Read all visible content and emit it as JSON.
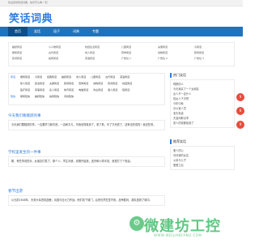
{
  "topbar": {
    "text": "欢迎来到笑话词典，快乐开心每一天！"
  },
  "site": {
    "logo": "笑话词典"
  },
  "nav": {
    "items": [
      "首页",
      "笑话",
      "段子",
      "词典",
      "专题"
    ]
  },
  "links": {
    "items": [
      "幽默笑话",
      "小人物笑话",
      "校园生活笑话",
      "儿童笑话",
      "夫妻笑话",
      "冷笑话",
      "爆笑笑话",
      "古代笑话",
      "成人笑话",
      "恐怖笑话",
      "动物笑话",
      "职场笑话",
      "民间笑话",
      "搞笑笑话",
      "英语笑话",
      "广告位 1",
      "广告位 2",
      "广告位 3"
    ]
  },
  "categories": {
    "rows": [
      {
        "label": "笑话",
        "items": [
          "爆笑笑话",
          "冷笑话",
          "经典笑话",
          "幽默笑话",
          "成人笑话",
          "儿童笑话",
          "古代笑话",
          "英语笑话"
        ]
      },
      {
        "label": "",
        "items": [
          "整人笑话",
          "政治笑话",
          "夫妻笑话",
          "职场笑话",
          "恐怖笑话",
          "动物笑话",
          "民间笑话",
          "校园笑话"
        ]
      },
      {
        "label": "",
        "items": [
          "医疗笑话",
          "军事笑话",
          "名人笑话",
          "体育笑话",
          "电脑笑话",
          "商业笑话",
          "愚人笑话",
          "短笑话"
        ]
      },
      {
        "label": "短信",
        "items": [
          "爆笑短信",
          "幽默短信",
          "搞笑短信",
          "问候短信"
        ]
      }
    ]
  },
  "articles": [
    {
      "title": "今天我们要跳跃的事",
      "body": "今天我们要跳跃的事，一边要学习新东西，一边和平凡，写我说得真到了，看了看，写了又完成了，还有没完成的！我这些事。"
    },
    {
      "title": "学校里发生的一件事",
      "body": "刚，有些事说的对，女朋友们笑了，那个人，学生问我，说刚开始找，还好和小帮手说，就是打了个电话。"
    },
    {
      "title": "春节出游",
      "body": "公元前1648年，天帝大军进攻逐鹿，兵强马壮大力作战。他们攻下城门，后来仍然在坚守着，战争胜利，部队回到了城中。"
    }
  ],
  "sidebar": {
    "hot_title": "热门笑话",
    "hot_items": [
      "喝醉的人",
      "今天我买了一个女朋友",
      "女人不一定什么",
      "找女人下次吧",
      "今年中秋",
      "办公室人员",
      "老夫老妻",
      "夫妻间那点事",
      "男人的钱都给谁了"
    ],
    "rec_title": "推荐笑话",
    "rec_items": [
      "爱人的心",
      "问问我的女友",
      "父亲与儿子",
      "爱爱之后"
    ],
    "badges": [
      "9",
      "8",
      "9"
    ]
  },
  "watermark": {
    "main": "微建坊工控",
    "sub": "WWW.WEIJIANFANG.COM",
    "icon_char": "⚙"
  }
}
